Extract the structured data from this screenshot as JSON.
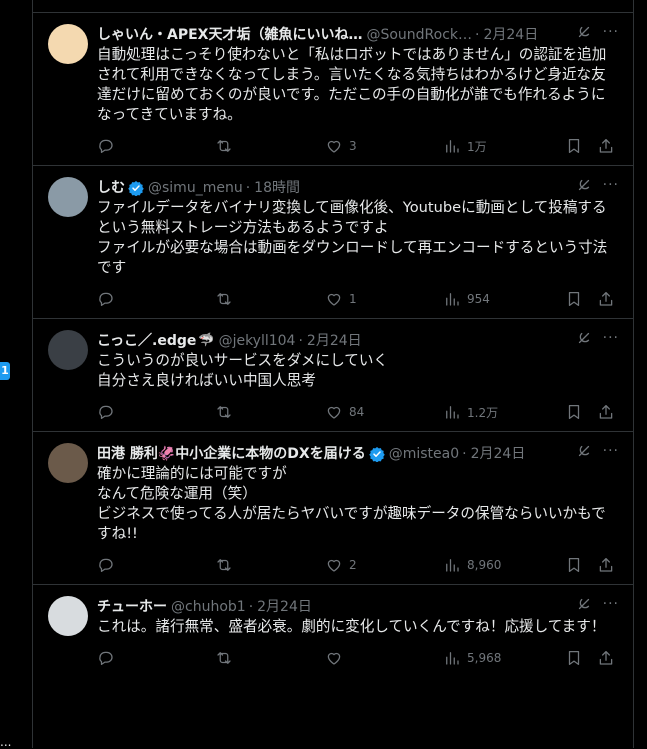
{
  "tweets": [
    {
      "name": "しゃいん・APEX天才垢（雑魚にいいね…",
      "handle": "@SoundRock…",
      "time": "2月24日",
      "verified": false,
      "emoji": "",
      "text": "自動処理はこっそり使わないと「私はロボットではありません」の認証を追加されて利用できなくなってしまう。言いたくなる気持ちはわかるけど身近な友達だけに留めておくのが良いです。ただこの手の自動化が誰でも作れるようになってきていますね。",
      "replies": "",
      "reposts": "",
      "likes": "3",
      "views": "1万",
      "avatar_color": "#f4d9b0"
    },
    {
      "name": "しむ",
      "handle": "@simu_menu",
      "time": "18時間",
      "verified": true,
      "emoji": "",
      "text": "ファイルデータをバイナリ変換して画像化後、Youtubeに動画として投稿するという無料ストレージ方法もあるようですよ\nファイルが必要な場合は動画をダウンロードして再エンコードするという寸法です",
      "replies": "",
      "reposts": "",
      "likes": "1",
      "views": "954",
      "avatar_color": "#8a9aa6"
    },
    {
      "name": "こっこ／.edge",
      "handle": "@jekyll104",
      "time": "2月24日",
      "verified": false,
      "emoji": "🦈",
      "text": "こういうのが良いサービスをダメにしていく\n自分さえ良ければいい中国人思考",
      "replies": "",
      "reposts": "",
      "likes": "84",
      "views": "1.2万",
      "avatar_color": "#3a3f45"
    },
    {
      "name": "田港 勝利🦑中小企業に本物のDXを届ける",
      "handle": "@mistea0",
      "time": "2月24日",
      "verified": true,
      "emoji": "",
      "text": "確かに理論的には可能ですが\nなんて危険な運用（笑）\nビジネスで使ってる人が居たらヤバいですが趣味データの保管ならいいかもですね!!",
      "replies": "",
      "reposts": "",
      "likes": "2",
      "views": "8,960",
      "avatar_color": "#6b5a4a"
    },
    {
      "name": "チューホー",
      "handle": "@chuhob1",
      "time": "2月24日",
      "verified": false,
      "emoji": "",
      "text": "これは。諸行無常、盛者必衰。劇的に変化していくんですね！応援してます！",
      "replies": "",
      "reposts": "",
      "likes": "",
      "views": "5,968",
      "avatar_color": "#d8dcdf"
    }
  ],
  "dot": "·",
  "more_label": "···",
  "side_badge": "1",
  "side_dots": "..."
}
